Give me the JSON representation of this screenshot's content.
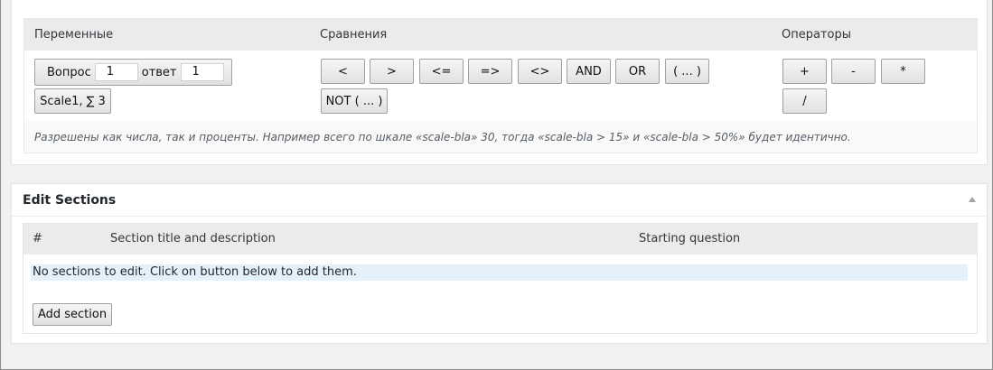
{
  "insert": {
    "columns": {
      "variables": "Переменные",
      "comparisons": "Сравнения",
      "operators": "Операторы"
    },
    "variables": {
      "question_label": "Вопрос",
      "question_value": "1",
      "answer_label": "ответ",
      "answer_value": "1",
      "scale_label": "Scale1, ∑ 3"
    },
    "comparisons": [
      "<",
      ">",
      "<=",
      "=>",
      "<>",
      "AND",
      "OR",
      "( ... )",
      "NOT ( ... )"
    ],
    "operators": [
      "+",
      "-",
      "*",
      "/"
    ],
    "hint": "Разрешены как числа, так и проценты. Например всего по шкале «scale-bla» 30, тогда «scale-bla > 15» и «scale-bla > 50%» будет идентично."
  },
  "sections": {
    "title": "Edit Sections",
    "toggle_icon": "triangle-up-icon",
    "headers": [
      "#",
      "Section title and description",
      "Starting question"
    ],
    "empty_message": "No sections to edit. Click on button below to add them.",
    "add_button": "Add section"
  },
  "colors": {
    "page_bg": "#f1f1f1",
    "header_bg": "#ebebeb",
    "empty_row_bg": "#e4f1fb"
  }
}
